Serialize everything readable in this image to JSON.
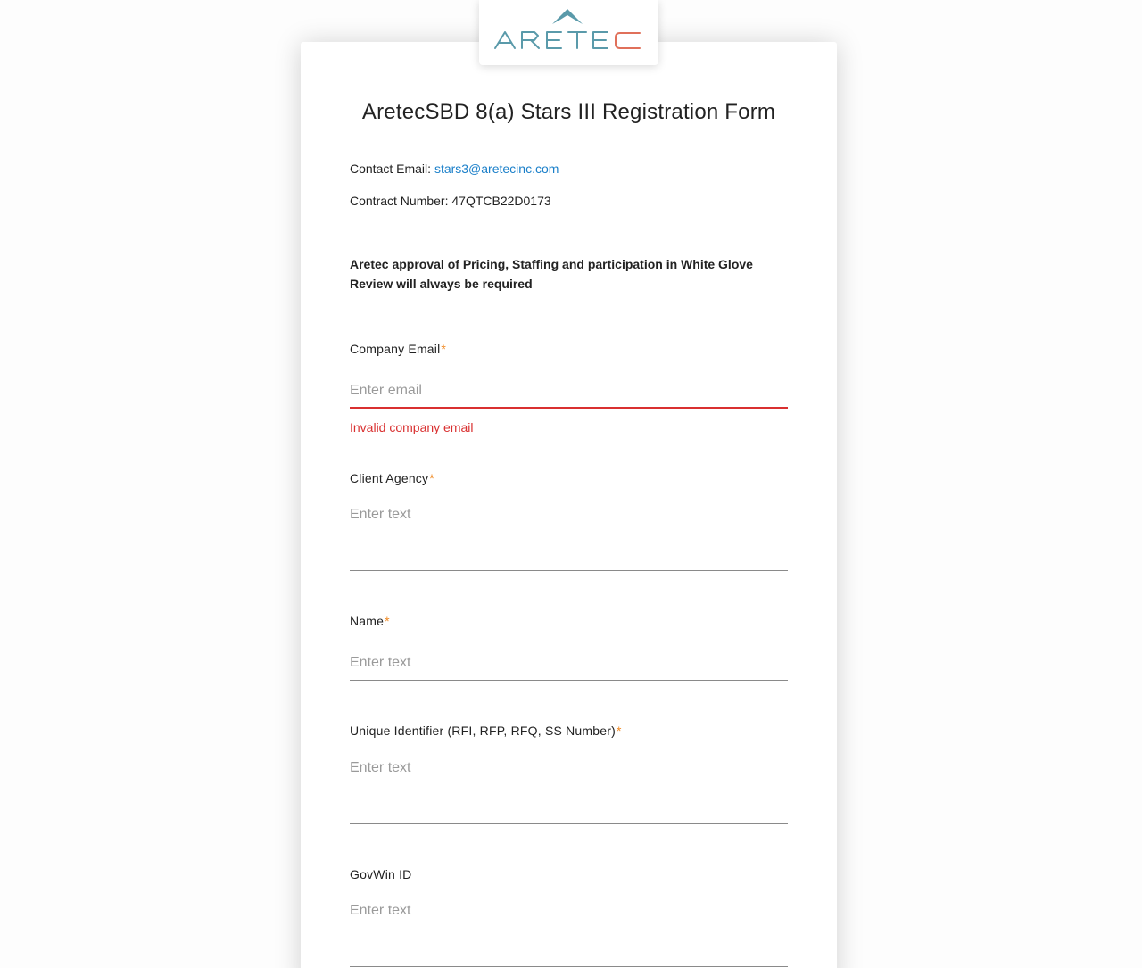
{
  "logo": {
    "text": "ARETEC",
    "primary_color": "#5a9aaa",
    "accent_color": "#e0705a"
  },
  "form": {
    "title": "AretecSBD 8(a) Stars III Registration Form",
    "contact_label": "Contact Email: ",
    "contact_email": "stars3@aretecinc.com",
    "contract_label": "Contract Number: ",
    "contract_number": "47QTCB22D0173",
    "notice": "Aretec approval of Pricing, Staffing and participation in White Glove Review will always be required",
    "required_marker": "*"
  },
  "fields": {
    "company_email": {
      "label": "Company Email",
      "placeholder": "Enter email",
      "value": "",
      "error": "Invalid company email"
    },
    "client_agency": {
      "label": "Client Agency",
      "placeholder": "Enter text",
      "value": ""
    },
    "name": {
      "label": "Name",
      "placeholder": "Enter text",
      "value": ""
    },
    "unique_identifier": {
      "label": "Unique Identifier (RFI, RFP, RFQ, SS Number)",
      "placeholder": "Enter text",
      "value": ""
    },
    "govwin_id": {
      "label": "GovWin ID",
      "placeholder": "Enter text",
      "value": ""
    }
  },
  "colors": {
    "link": "#1a7fc9",
    "error": "#d93030",
    "required": "#f08a24"
  }
}
